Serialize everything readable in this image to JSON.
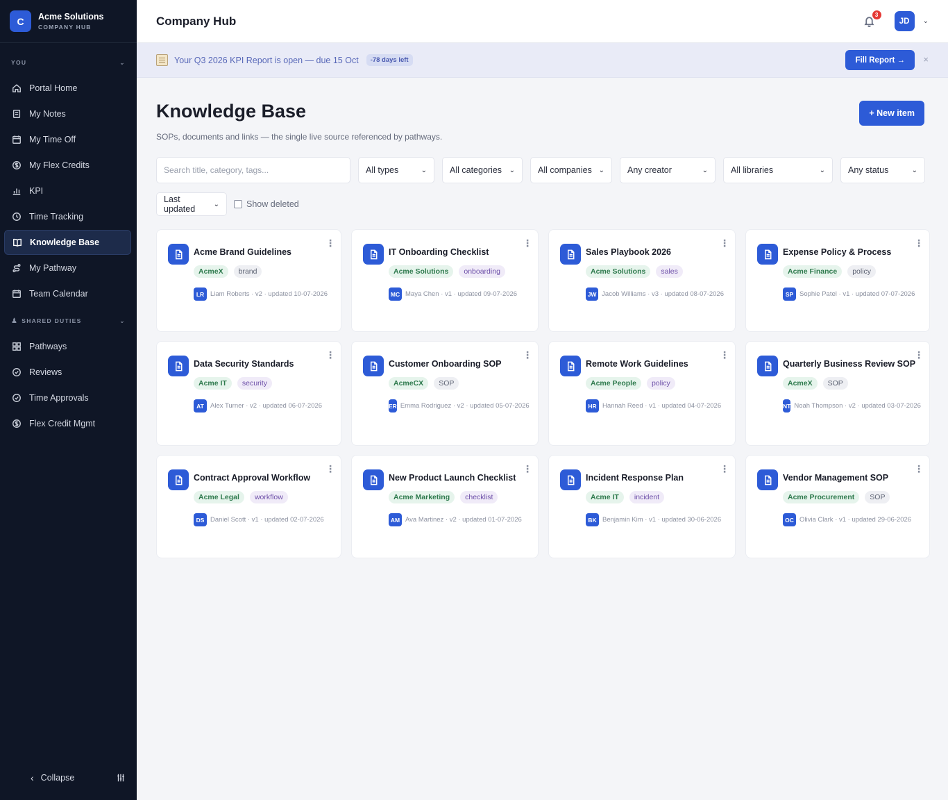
{
  "brand": {
    "logo_letter": "C",
    "name": "Acme Solutions",
    "subtitle": "COMPANY HUB"
  },
  "sidebar": {
    "section_you": "YOU",
    "you_items": [
      {
        "label": "Portal Home",
        "icon": "home-icon"
      },
      {
        "label": "My Notes",
        "icon": "notes-icon"
      },
      {
        "label": "My Time Off",
        "icon": "calendar-icon"
      },
      {
        "label": "My Flex Credits",
        "icon": "dollar-icon"
      },
      {
        "label": "KPI",
        "icon": "chart-icon"
      },
      {
        "label": "Time Tracking",
        "icon": "clock-icon"
      },
      {
        "label": "Knowledge Base",
        "icon": "book-icon",
        "active": true
      },
      {
        "label": "My Pathway",
        "icon": "route-icon"
      },
      {
        "label": "Team Calendar",
        "icon": "calendar-icon"
      }
    ],
    "section_shared": "SHARED DUTIES",
    "shared_items": [
      {
        "label": "Pathways",
        "icon": "grid-icon"
      },
      {
        "label": "Reviews",
        "icon": "check-circle-icon"
      },
      {
        "label": "Time Approvals",
        "icon": "check-circle-icon"
      },
      {
        "label": "Flex Credit Mgmt",
        "icon": "dollar-icon"
      }
    ],
    "collapse_label": "Collapse"
  },
  "topbar": {
    "title": "Company Hub",
    "notification_count": "3",
    "avatar_initials": "JD"
  },
  "banner": {
    "text": "Your Q3 2026 KPI Report is open — due 15 Oct",
    "pill": "-78 days left",
    "button": "Fill Report →",
    "close": "×"
  },
  "page": {
    "title": "Knowledge Base",
    "subtitle": "SOPs, documents and links — the single live source referenced by pathways.",
    "new_button": "+ New item"
  },
  "filters": {
    "search_placeholder": "Search title, category, tags...",
    "types": "All types",
    "categories": "All categories",
    "companies": "All companies",
    "creator": "Any creator",
    "libraries": "All libraries",
    "status": "Any status",
    "sort": "Last updated",
    "show_deleted": "Show deleted"
  },
  "colors": {
    "accent": "#2d5bd7",
    "sidebar_bg": "#0f1626",
    "banner_bg": "#e9ebf7"
  },
  "cards": [
    {
      "title": "Acme Brand Guidelines",
      "company": "AcmeX",
      "category": "brand",
      "initials": "LR",
      "meta": "Liam Roberts · v2 · updated 10-07-2026"
    },
    {
      "title": "IT Onboarding Checklist",
      "company": "Acme Solutions",
      "category": "onboarding",
      "initials": "MC",
      "meta": "Maya Chen · v1 · updated 09-07-2026"
    },
    {
      "title": "Sales Playbook 2026",
      "company": "Acme Solutions",
      "category": "sales",
      "initials": "JW",
      "meta": "Jacob Williams · v3 · updated 08-07-2026"
    },
    {
      "title": "Expense Policy & Process",
      "company": "Acme Finance",
      "category": "policy",
      "initials": "SP",
      "meta": "Sophie Patel · v1 · updated 07-07-2026"
    },
    {
      "title": "Data Security Standards",
      "company": "Acme IT",
      "category": "security",
      "initials": "AT",
      "meta": "Alex Turner · v2 · updated 06-07-2026"
    },
    {
      "title": "Customer Onboarding SOP",
      "company": "AcmeCX",
      "category": "SOP",
      "initials": "ER",
      "meta": "Emma Rodriguez · v2 · updated 05-07-2026"
    },
    {
      "title": "Remote Work Guidelines",
      "company": "Acme People",
      "category": "policy",
      "initials": "HR",
      "meta": "Hannah Reed · v1 · updated 04-07-2026"
    },
    {
      "title": "Quarterly Business Review SOP",
      "company": "AcmeX",
      "category": "SOP",
      "initials": "NT",
      "meta": "Noah Thompson · v2 · updated 03-07-2026"
    },
    {
      "title": "Contract Approval Workflow",
      "company": "Acme Legal",
      "category": "workflow",
      "initials": "DS",
      "meta": "Daniel Scott · v1 · updated 02-07-2026"
    },
    {
      "title": "New Product Launch Checklist",
      "company": "Acme Marketing",
      "category": "checklist",
      "initials": "AM",
      "meta": "Ava Martinez · v2 · updated 01-07-2026"
    },
    {
      "title": "Incident Response Plan",
      "company": "Acme IT",
      "category": "incident",
      "initials": "BK",
      "meta": "Benjamin Kim · v1 · updated 30-06-2026"
    },
    {
      "title": "Vendor Management SOP",
      "company": "Acme Procurement",
      "category": "SOP",
      "initials": "OC",
      "meta": "Olivia Clark · v1 · updated 29-06-2026"
    }
  ]
}
